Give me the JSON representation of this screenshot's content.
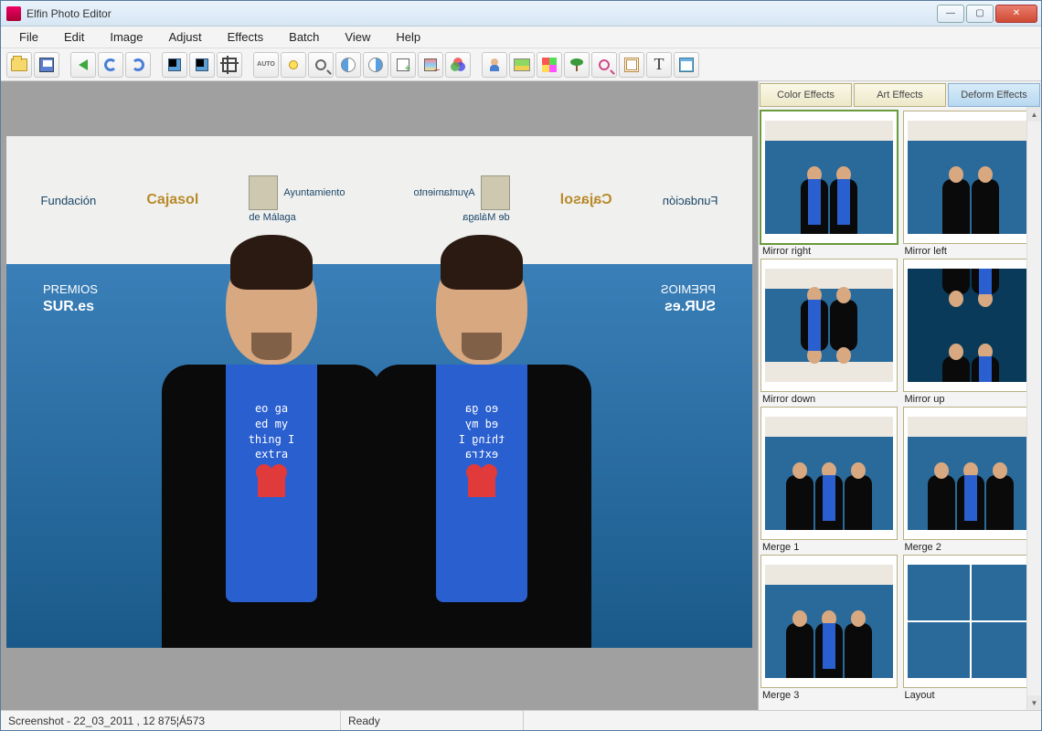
{
  "window": {
    "title": "Elfin Photo Editor"
  },
  "menu": [
    "File",
    "Edit",
    "Image",
    "Adjust",
    "Effects",
    "Batch",
    "View",
    "Help"
  ],
  "toolbar_auto": "AUTO",
  "toolbar_text": "T",
  "canvas": {
    "sponsors": {
      "fundacion": "Fundación",
      "cajasol": "Cajasol",
      "malaga_l1": "Ayuntamiento",
      "malaga_l2": "de Málaga"
    },
    "premios_l1": "PREMIOS",
    "premios_l2": "SUR.es",
    "shirt_l1": "eo ga",
    "shirt_l2": "ed my",
    "shirt_l3": "thing I",
    "shirt_l4": "extra"
  },
  "tabs": [
    {
      "label": "Color Effects",
      "active": false
    },
    {
      "label": "Art Effects",
      "active": false
    },
    {
      "label": "Deform Effects",
      "active": true
    }
  ],
  "effects": [
    {
      "label": "Mirror right",
      "selected": true
    },
    {
      "label": "Mirror left",
      "selected": false
    },
    {
      "label": "Mirror down",
      "selected": false
    },
    {
      "label": "Mirror up",
      "selected": false
    },
    {
      "label": "Merge 1",
      "selected": false
    },
    {
      "label": "Merge 2",
      "selected": false
    },
    {
      "label": "Merge 3",
      "selected": false
    },
    {
      "label": "Layout",
      "selected": false
    }
  ],
  "status": {
    "filename": "Screenshot - 22_03_2011 , 12 875¦Á573",
    "ready": "Ready"
  }
}
